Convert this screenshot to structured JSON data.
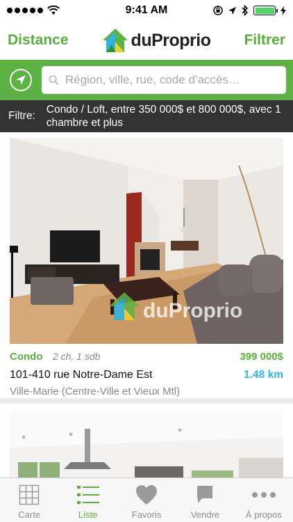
{
  "status_bar": {
    "time": "9:41 AM",
    "signal_icon": "signal-dots-icon",
    "wifi_icon": "wifi-icon",
    "icons_right": [
      "orientation-lock-icon",
      "location-arrow-icon",
      "bluetooth-icon",
      "battery-icon"
    ]
  },
  "navbar": {
    "left_button": "Distance",
    "logo_text": "duProprio",
    "right_button": "Filtrer",
    "accent_color": "#5aaf3c"
  },
  "search": {
    "placeholder": "Région, ville, rue, code d’accès…",
    "value": "",
    "bar_color": "#5cb243"
  },
  "filter": {
    "label": "Filtre:",
    "value": "Condo / Loft, entre 350 000$ et 800 000$, avec 1 chambre et plus"
  },
  "listings": [
    {
      "type": "Condo",
      "rooms": "2 ch, 1 sdb",
      "price": "399 000$",
      "address": "101-410 rue Notre-Dame Est",
      "distance": "1.48 km",
      "district": "Ville-Marie (Centre-Ville et Vieux Mtl)",
      "watermark": "duProprio"
    },
    {
      "type": "",
      "rooms": "",
      "price": "",
      "address": "",
      "distance": "",
      "district": ""
    }
  ],
  "tabs": [
    {
      "label": "Carte",
      "icon": "grid-map-icon",
      "active": false
    },
    {
      "label": "Liste",
      "icon": "list-icon",
      "active": true
    },
    {
      "label": "Favoris",
      "icon": "heart-icon",
      "active": false
    },
    {
      "label": "Vendre",
      "icon": "flag-icon",
      "active": false
    },
    {
      "label": "À propos",
      "icon": "more-dots-icon",
      "active": false
    }
  ],
  "colors": {
    "price": "#5aaf3c",
    "distance": "#2cb5e6",
    "filter_bg": "#333333"
  }
}
